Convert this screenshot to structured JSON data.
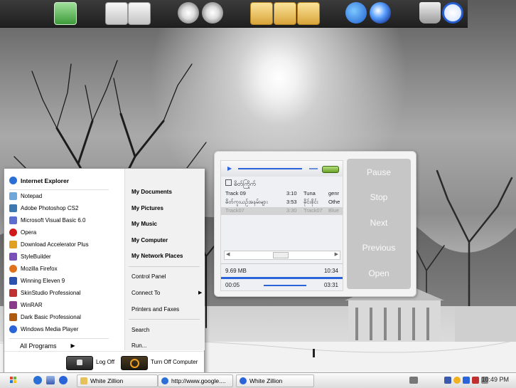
{
  "dock": {
    "icons": [
      "chart-icon",
      "window-icon",
      "window-icon",
      "disc-icon",
      "disc-burn-icon",
      "folder-icon",
      "folder-music-icon",
      "folder-pictures-icon",
      "internet-explorer-icon",
      "media-player-icon",
      "recycle-bin-icon",
      "clock-icon"
    ]
  },
  "start_menu": {
    "pinned": [
      {
        "label": "Internet Explorer",
        "icon": "internet-explorer-icon",
        "color": "#2a6fd6"
      }
    ],
    "programs": [
      {
        "label": "Notepad",
        "icon": "notepad-icon",
        "color": "#6fa8d8"
      },
      {
        "label": "Adobe Photoshop CS2",
        "icon": "photoshop-icon",
        "color": "#3b78b0"
      },
      {
        "label": "Microsoft Visual Basic 6.0",
        "icon": "visual-basic-icon",
        "color": "#5a6fd0"
      },
      {
        "label": "Opera",
        "icon": "opera-icon",
        "color": "#d01a1a"
      },
      {
        "label": "Download Accelerator Plus",
        "icon": "download-accelerator-icon",
        "color": "#e0a020"
      },
      {
        "label": "StyleBuilder",
        "icon": "stylebuilder-icon",
        "color": "#7a4fb8"
      },
      {
        "label": "Mozilla Firefox",
        "icon": "firefox-icon",
        "color": "#e0701a"
      },
      {
        "label": "Winning Eleven 9",
        "icon": "winning-eleven-icon",
        "color": "#2a50b0"
      },
      {
        "label": "SkinStudio Professional",
        "icon": "skinstudio-icon",
        "color": "#c03030"
      },
      {
        "label": "WinRAR",
        "icon": "winrar-icon",
        "color": "#8a3a8a"
      },
      {
        "label": "Dark Basic Professional",
        "icon": "dark-basic-icon",
        "color": "#b05a10"
      },
      {
        "label": "Windows Media Player",
        "icon": "windows-media-player-icon",
        "color": "#2a64d8"
      }
    ],
    "all_programs": "All Programs",
    "places": [
      "My Documents",
      "My Pictures",
      "My Music",
      "My Computer",
      "My Network Places"
    ],
    "system": [
      "Control Panel",
      "Connect To",
      "Printers and Faxes"
    ],
    "extra": [
      "Search",
      "Run..."
    ],
    "log_off": "Log Off",
    "turn_off": "Turn Off Computer"
  },
  "player": {
    "now_playing": "ဓိတ်ကြိုက်",
    "tracks": [
      {
        "title": "Track 09",
        "time": "3:10",
        "artist": "Tuna",
        "genre": "genr"
      },
      {
        "title": "ဓိတ်ကူးယဉ်အနမ်းများ",
        "time": "3:53",
        "artist": "ဓိုင်းစိုင်း",
        "genre": "Othe"
      },
      {
        "title": "Track07",
        "time": "3:30",
        "artist": "Track07",
        "genre": "Blue"
      }
    ],
    "size": "9.69 MB",
    "total": "10:34",
    "elapsed": "00:05",
    "duration": "03:31",
    "buttons": [
      "Pause",
      "Stop",
      "Next",
      "Previous",
      "Open"
    ]
  },
  "taskbar": {
    "tasks": [
      {
        "label": "White Zillion",
        "icon": "folder-icon",
        "color": "#e6c15a"
      },
      {
        "label": "http://www.google....",
        "icon": "internet-explorer-icon",
        "color": "#2a6fd6"
      },
      {
        "label": "White Zillion",
        "icon": "media-player-icon",
        "color": "#2a64d8"
      }
    ],
    "clock": "10:49 PM"
  }
}
